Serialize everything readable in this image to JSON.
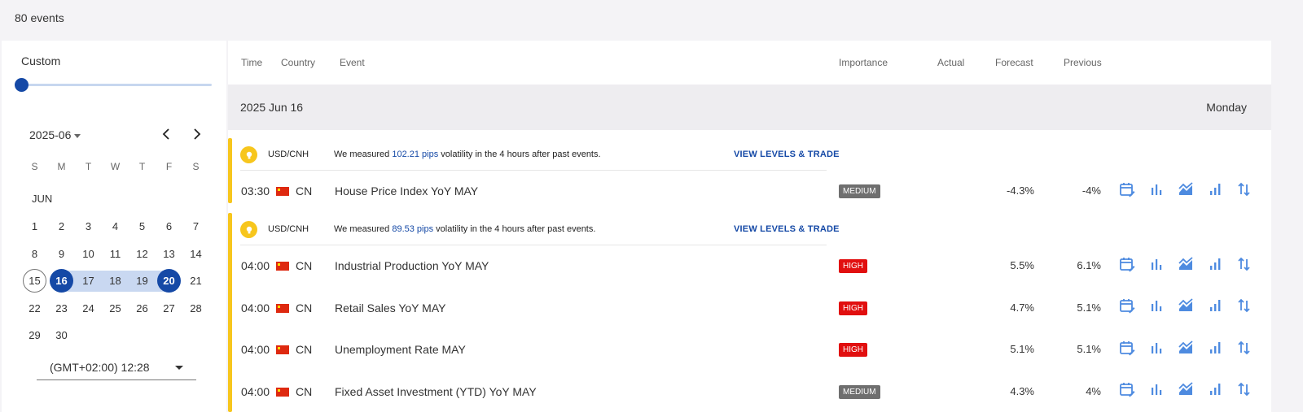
{
  "header": {
    "event_count": "80 events"
  },
  "sidebar": {
    "range_label": "Custom",
    "calendar": {
      "month_select": "2025-06",
      "weekdays": [
        "S",
        "M",
        "T",
        "W",
        "T",
        "F",
        "S"
      ],
      "month_label": "JUN",
      "weeks": [
        [
          "1",
          "2",
          "3",
          "4",
          "5",
          "6",
          "7"
        ],
        [
          "8",
          "9",
          "10",
          "11",
          "12",
          "13",
          "14"
        ],
        [
          "15",
          "16",
          "17",
          "18",
          "19",
          "20",
          "21"
        ],
        [
          "22",
          "23",
          "24",
          "25",
          "26",
          "27",
          "28"
        ],
        [
          "29",
          "30"
        ]
      ],
      "today": "15",
      "range_start": "16",
      "range_end": "20"
    },
    "timezone": "(GMT+02:00) 12:28"
  },
  "columns": {
    "time": "Time",
    "country": "Country",
    "event": "Event",
    "importance": "Importance",
    "actual": "Actual",
    "forecast": "Forecast",
    "previous": "Previous"
  },
  "date_band": {
    "date": "2025 Jun 16",
    "day": "Monday"
  },
  "groups": [
    {
      "insight": {
        "pair": "USD/CNH",
        "msg_before": "We measured ",
        "highlight": "102.21 pips",
        "msg_after": " volatility in the 4 hours after past events.",
        "cta": "VIEW LEVELS & TRADE"
      },
      "events": [
        {
          "time": "03:30",
          "country": "CN",
          "name": "House Price Index YoY MAY",
          "importance": "MEDIUM",
          "actual": "",
          "forecast": "-4.3%",
          "previous": "-4%"
        }
      ]
    },
    {
      "insight": {
        "pair": "USD/CNH",
        "msg_before": "We measured ",
        "highlight": "89.53 pips",
        "msg_after": " volatility in the 4 hours after past events.",
        "cta": "VIEW LEVELS & TRADE"
      },
      "events": [
        {
          "time": "04:00",
          "country": "CN",
          "name": "Industrial Production YoY MAY",
          "importance": "HIGH",
          "actual": "",
          "forecast": "5.5%",
          "previous": "6.1%"
        },
        {
          "time": "04:00",
          "country": "CN",
          "name": "Retail Sales YoY MAY",
          "importance": "HIGH",
          "actual": "",
          "forecast": "4.7%",
          "previous": "5.1%"
        },
        {
          "time": "04:00",
          "country": "CN",
          "name": "Unemployment Rate MAY",
          "importance": "HIGH",
          "actual": "",
          "forecast": "5.1%",
          "previous": "5.1%"
        },
        {
          "time": "04:00",
          "country": "CN",
          "name": "Fixed Asset Investment (YTD) YoY MAY",
          "importance": "MEDIUM",
          "actual": "",
          "forecast": "4.3%",
          "previous": "4%"
        }
      ]
    }
  ],
  "icons": {
    "action_icons": [
      "calendar-edit-icon",
      "bar-chart-icon",
      "area-chart-icon",
      "signal-bars-icon",
      "sort-arrows-icon"
    ],
    "accent": "#1549a6",
    "icon_color": "#4e8be0",
    "importance_high": "#e10f0f",
    "importance_medium": "#6f6f6f",
    "insight_yellow": "#f7c61d"
  }
}
